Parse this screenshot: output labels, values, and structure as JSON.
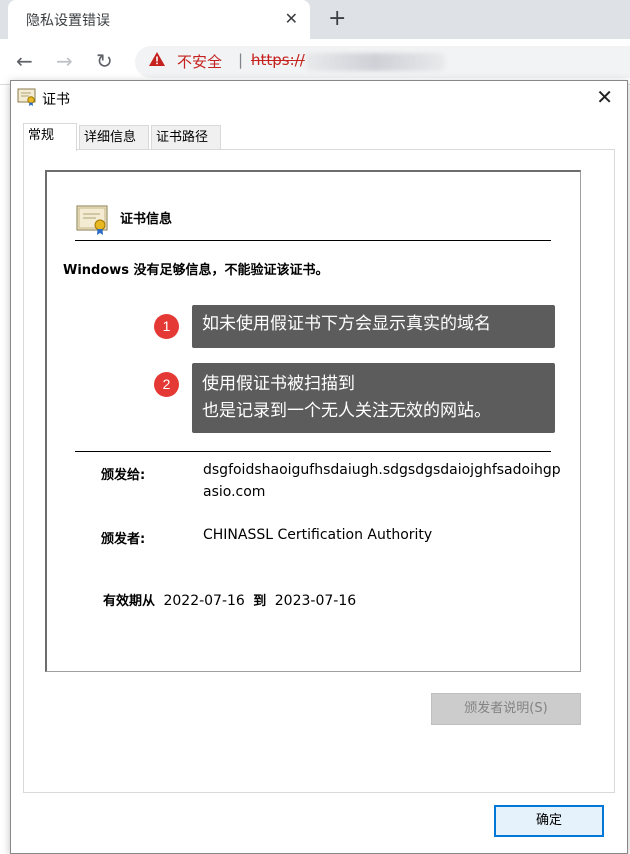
{
  "browser": {
    "tab_title": "隐私设置错误",
    "tab_close": "✕",
    "new_tab": "+",
    "nav": {
      "back": "←",
      "forward": "→",
      "reload": "↻"
    },
    "omnibox": {
      "warning_icon": "warning-triangle-icon",
      "security_label": "不安全",
      "separator": "|",
      "url_scheme": "https://"
    }
  },
  "dialog": {
    "title": "证书",
    "close": "✕",
    "tabs": [
      {
        "label": "常规"
      },
      {
        "label": "详细信息"
      },
      {
        "label": "证书路径"
      }
    ],
    "cert_info": {
      "heading": "证书信息",
      "warning": "Windows 没有足够信息，不能验证该证书。",
      "issued_to_label": "颁发给:",
      "issued_to_value": "dsgfoidshaoigufhsdaiugh.sdgsdgsdaiojghfsadoihgpasio.com",
      "issued_by_label": "颁发者:",
      "issued_by_value": "CHINASSL Certification Authority",
      "validity_label": "有效期从",
      "valid_from": "2022-07-16",
      "validity_to_word": "到",
      "valid_to": "2023-07-16"
    },
    "annotations": [
      {
        "number": "1",
        "lines": [
          "如未使用假证书下方会显示真实的域名"
        ]
      },
      {
        "number": "2",
        "lines": [
          "使用假证书被扫描到",
          "也是记录到一个无人关注无效的网站。"
        ]
      }
    ],
    "buttons": {
      "issuer_statement": "颁发者说明(S)",
      "ok": "确定"
    }
  },
  "colors": {
    "warning_red": "#c5221f",
    "callout_bg": "#5c5c5c",
    "badge_red": "#e53935",
    "focus_blue": "#0078d7"
  }
}
